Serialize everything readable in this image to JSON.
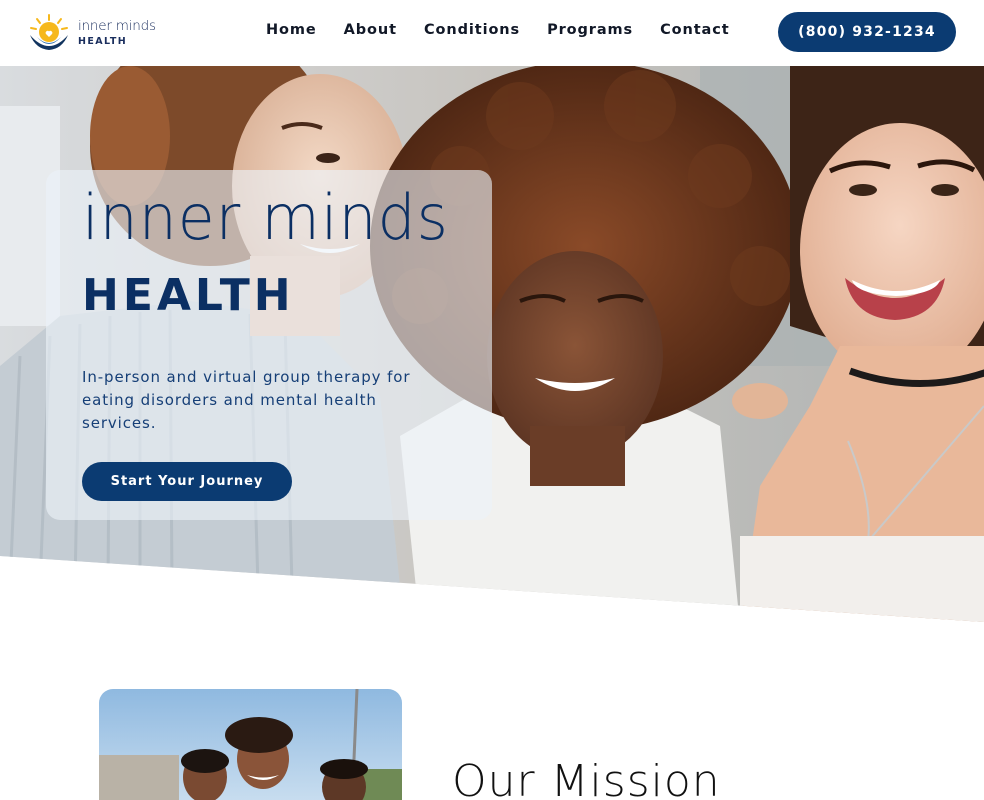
{
  "brand": {
    "name_line1": "inner minds",
    "name_line2": "HEALTH",
    "colors": {
      "navy": "#0b3b72",
      "sun": "#f6b81c",
      "white": "#ffffff"
    },
    "logo_icon": "sun-hands-icon"
  },
  "nav": {
    "items": [
      {
        "label": "Home"
      },
      {
        "label": "About"
      },
      {
        "label": "Conditions"
      },
      {
        "label": "Programs"
      },
      {
        "label": "Contact"
      }
    ],
    "phone_label": "(800) 932-1234"
  },
  "hero": {
    "title_line1": "inner minds",
    "title_line2": "HEALTH",
    "subtitle": "In-person and virtual group therapy for eating disorders and mental health services.",
    "cta_label": "Start Your Journey"
  },
  "mission": {
    "title": "Our Mission"
  }
}
